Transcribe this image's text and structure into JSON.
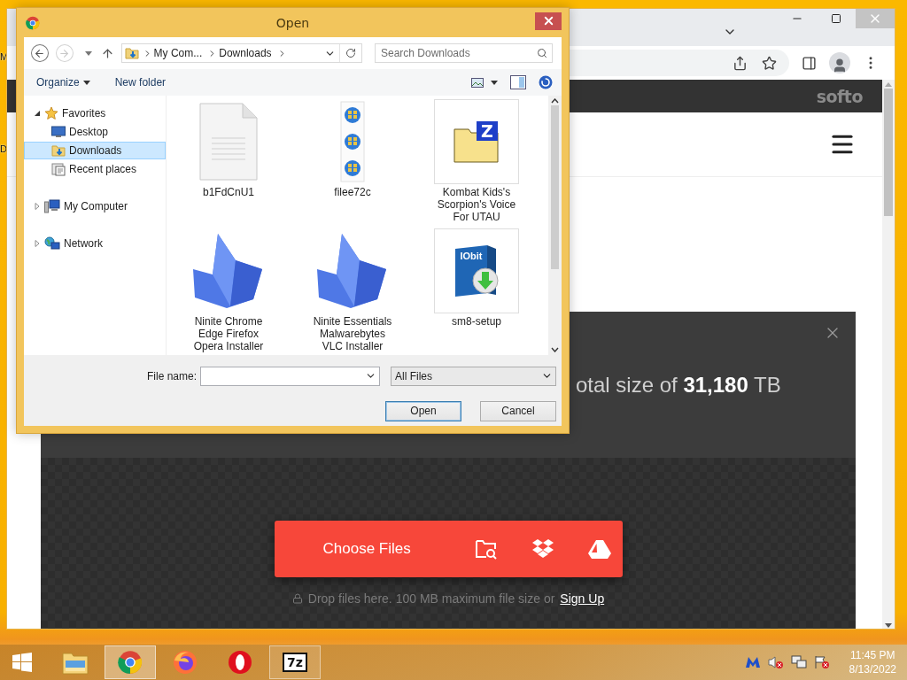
{
  "desktop": {
    "icon_labels": [
      "M",
      "D"
    ]
  },
  "browser": {
    "logo": "softo",
    "banner": {
      "text": "otal size of **31,180** TB",
      "button": "Choose Files",
      "note": "Drop files here. 100 MB maximum file size or",
      "link": "Sign Up"
    }
  },
  "dialog": {
    "title": "Open",
    "nav_buttons": [
      {
        "kind": "back",
        "disabled": false
      },
      {
        "kind": "forward",
        "disabled": true
      }
    ],
    "breadcrumb": [
      "My Com...",
      "Downloads"
    ],
    "search": {
      "placeholder": "Search Downloads"
    },
    "toolbar": [
      {
        "label": "Organize",
        "menu": true
      },
      {
        "label": "New folder",
        "menu": false
      }
    ],
    "tree": [
      {
        "label": "Favorites",
        "kind": "star",
        "expanded": true,
        "selected": false,
        "children": [
          {
            "label": "Desktop",
            "kind": "desktop",
            "selected": false
          },
          {
            "label": "Downloads",
            "kind": "downloads",
            "selected": true
          },
          {
            "label": "Recent places",
            "kind": "recent",
            "selected": false
          }
        ]
      },
      {
        "label": "My Computer",
        "kind": "computer",
        "expanded": false,
        "selected": false
      },
      {
        "label": "Network",
        "kind": "network",
        "expanded": false,
        "selected": false
      }
    ],
    "files": [
      {
        "name": "b1FdCnU1",
        "kind": "document"
      },
      {
        "name": "filee72c",
        "kind": "strip"
      },
      {
        "name": "Kombat Kids's Scorpion's Voice For UTAU",
        "kind": "archive",
        "badge": "Z"
      },
      {
        "name": "Ninite Chrome Edge Firefox Opera Installer",
        "kind": "crystal"
      },
      {
        "name": "Ninite Essentials Malwarebytes VLC Installer",
        "kind": "crystal"
      },
      {
        "name": "sm8-setup",
        "kind": "setup",
        "badge": "IObit"
      }
    ],
    "file_name": {
      "label": "File name:"
    },
    "file_type": {
      "value": "All Files"
    },
    "buttons": [
      {
        "label": "Open",
        "default": true
      },
      {
        "label": "Cancel",
        "default": false
      }
    ]
  },
  "taskbar": {
    "apps": [
      {
        "kind": "explorer",
        "active": false,
        "running": false
      },
      {
        "kind": "chrome",
        "active": true,
        "running": true
      },
      {
        "kind": "firefox",
        "active": false,
        "running": false
      },
      {
        "kind": "opera",
        "active": false,
        "running": false
      },
      {
        "kind": "sevenzip",
        "active": false,
        "running": true,
        "label": "7z"
      }
    ],
    "clock": {
      "time": "11:45 PM",
      "date": "8/13/2022"
    }
  }
}
